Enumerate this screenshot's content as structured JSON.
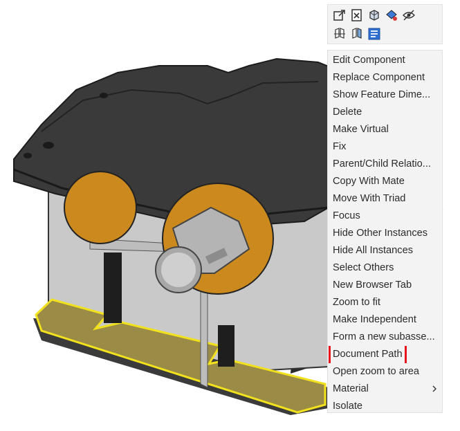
{
  "toolbar": {
    "icons": [
      "open-in-new-window-icon",
      "delete-document-icon",
      "component-box-icon",
      "appearance-paint-icon",
      "hide-eye-icon",
      "flip-direction-icon",
      "move-copy-icon",
      "properties-list-icon"
    ]
  },
  "menu": {
    "items": [
      {
        "label": "Edit Component"
      },
      {
        "label": "Replace Component"
      },
      {
        "label": "Show Feature Dime..."
      },
      {
        "label": "Delete"
      },
      {
        "label": "Make Virtual"
      },
      {
        "label": "Fix"
      },
      {
        "label": "Parent/Child Relatio..."
      },
      {
        "label": "Copy With Mate"
      },
      {
        "label": "Move With Triad"
      },
      {
        "label": "Focus"
      },
      {
        "label": "Hide Other Instances"
      },
      {
        "label": "Hide All Instances"
      },
      {
        "label": "Select Others"
      },
      {
        "label": "New Browser Tab"
      },
      {
        "label": "Zoom to fit"
      },
      {
        "label": "Make Independent"
      },
      {
        "label": "Form a new subasse..."
      },
      {
        "label": "Document Path"
      },
      {
        "label": "Open zoom to area"
      },
      {
        "label": "Material"
      },
      {
        "label": "Isolate"
      }
    ],
    "highlighted_label": "Document Path",
    "submenu_item_label": "Material"
  },
  "colors": {
    "highlight_box": "#e8141c",
    "selected_face": "#9a8b46",
    "selection_edge": "#f2e21e",
    "housing_dark": "#3a3a3a",
    "housing_gray": "#c8c8c8",
    "gasket_orange": "#cc8a1e"
  }
}
